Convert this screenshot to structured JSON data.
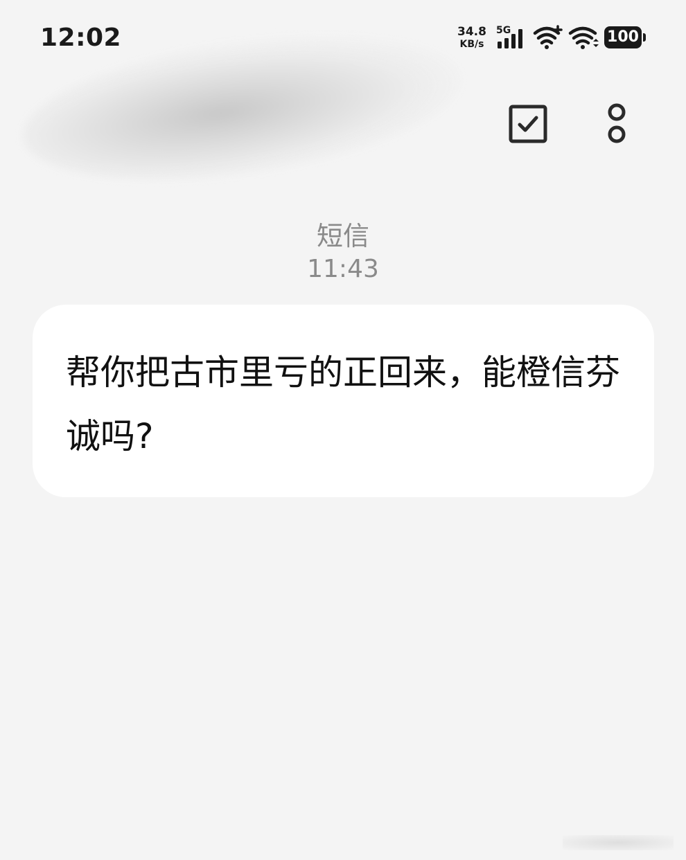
{
  "status_bar": {
    "time": "12:02",
    "net_speed_value": "34.8",
    "net_speed_unit": "KB/s",
    "network_type": "5G",
    "battery_level": "100"
  },
  "header": {
    "select_icon": "checkbox-icon",
    "more_icon": "more-vertical-icon"
  },
  "conversation": {
    "message_type": "短信",
    "message_time": "11:43",
    "messages": [
      {
        "text": "帮你把古市里亏的正回来，能橙信芬诚吗?"
      }
    ]
  }
}
